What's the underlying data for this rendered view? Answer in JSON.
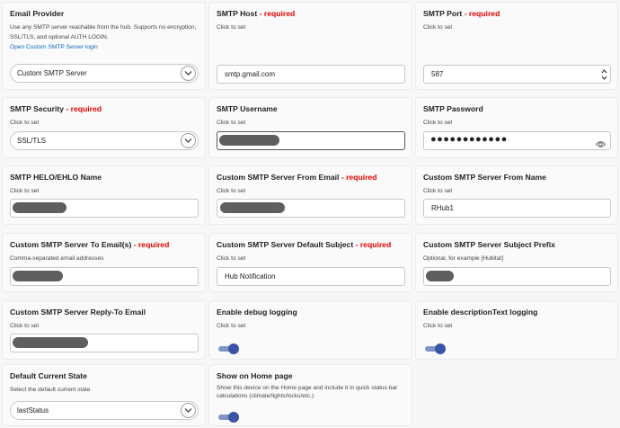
{
  "email_provider": {
    "title": "Email Provider",
    "desc_line1": "Use any SMTP server reachable from the hub. Supports no encryption,",
    "desc_line2": "SSL/TLS, and optional AUTH LOGIN.",
    "link": "Open Custom SMTP Server login",
    "value": "Custom SMTP Server"
  },
  "smtp_host": {
    "title": "SMTP Host",
    "required": "- required",
    "hint": "Click to set",
    "value": "smtp.gmail.com"
  },
  "smtp_port": {
    "title": "SMTP Port",
    "required": "- required",
    "hint": "Click to set",
    "value": "587"
  },
  "smtp_security": {
    "title": "SMTP Security",
    "required": "- required",
    "hint": "Click to set",
    "value": "SSL/TLS"
  },
  "smtp_username": {
    "title": "SMTP Username",
    "hint": "Click to set"
  },
  "smtp_password": {
    "title": "SMTP Password",
    "hint": "Click to set",
    "value": "●●●●●●●●●●●●"
  },
  "helo_name": {
    "title": "SMTP HELO/EHLO Name",
    "hint": "Click to set"
  },
  "from_email": {
    "title": "Custom SMTP Server From Email",
    "required": "- required",
    "hint": "Click to set"
  },
  "from_name": {
    "title": "Custom SMTP Server From Name",
    "hint": "Click to set",
    "value": "RHub1"
  },
  "to_emails": {
    "title": "Custom SMTP Server To Email(s)",
    "required": "- required",
    "hint": "Comma-separated email addresses"
  },
  "default_subject": {
    "title": "Custom SMTP Server Default Subject",
    "required": "- required",
    "hint": "Click to set",
    "value": "Hub Notification"
  },
  "subject_prefix": {
    "title": "Custom SMTP Server Subject Prefix",
    "hint": "Optional, for example [Hubitat]"
  },
  "reply_to": {
    "title": "Custom SMTP Server Reply-To Email",
    "hint": "Click to set"
  },
  "debug_logging": {
    "title": "Enable debug logging",
    "hint": "Click to set",
    "enabled": true
  },
  "desc_logging": {
    "title": "Enable descriptionText logging",
    "hint": "Click to set",
    "enabled": true
  },
  "default_state": {
    "title": "Default Current State",
    "hint": "Select the default current state",
    "value": "lastStatus"
  },
  "show_home": {
    "title": "Show on Home page",
    "desc_line1": "Show this device on the Home page and include it in quick status bar",
    "desc_line2": "calculations (climate/lights/locks/etc.)",
    "enabled": true
  },
  "colors": {
    "required": "#e00000",
    "link": "#1565c0",
    "toggle_knob": "#3b54a7",
    "toggle_track": "#7f95c6",
    "redaction": "#5e5e5e"
  },
  "icons": {
    "select": "chevron-down-icon",
    "password": "eye-icon",
    "number": "stepper-arrows-icon"
  }
}
